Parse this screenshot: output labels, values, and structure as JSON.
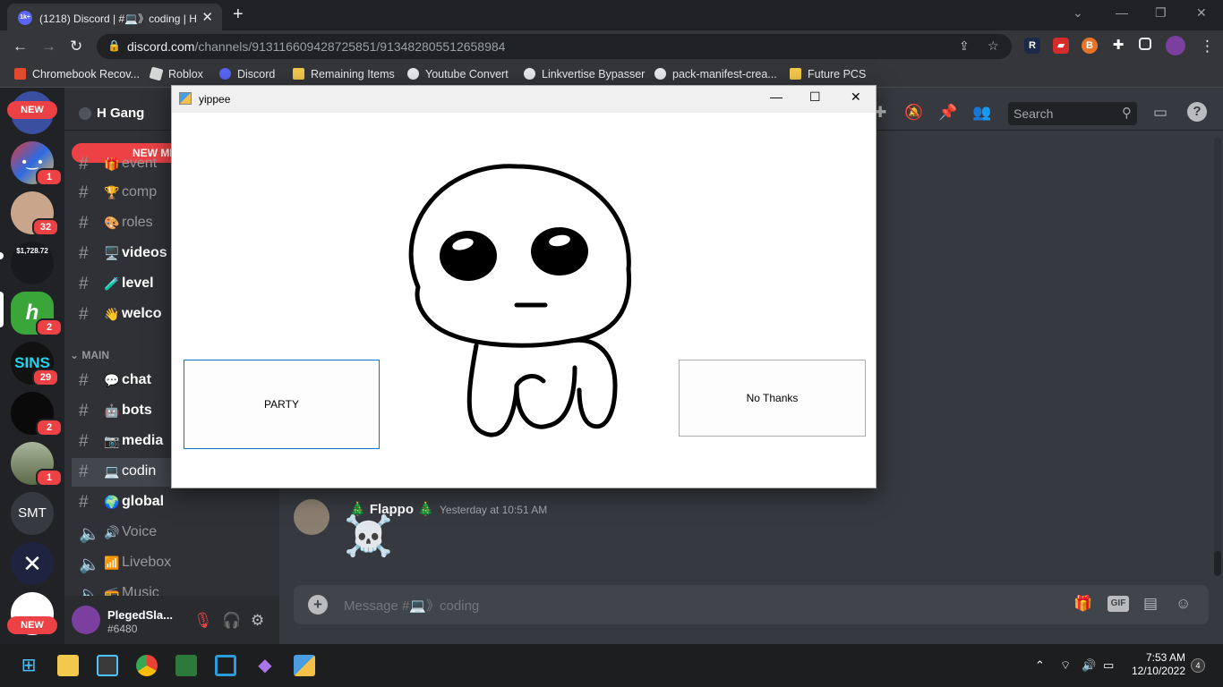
{
  "browser": {
    "tab_title": "(1218) Discord | #💻》coding | H",
    "tab_favicon": "1k+",
    "new_tab": "+",
    "url_host": "discord.com",
    "url_path": "/channels/913116609428725851/913482805512658984",
    "bookmarks": [
      "Chromebook Recov...",
      "Roblox",
      "Discord",
      "Remaining Items",
      "Youtube Convert",
      "Linkvertise Bypasser",
      "pack-manifest-crea...",
      "Future PCS"
    ]
  },
  "discord": {
    "server_name": "H Gang",
    "new_messages": "NEW ME",
    "guild_badges": {
      "g1": "1",
      "g2": "32",
      "g4": "2",
      "g5": "29",
      "g6": "2",
      "g7": "1"
    },
    "guild_labels": {
      "price": "$1,728.72",
      "smt": "SMT",
      "sins": "SINS",
      "new": "NEW",
      "new2": "NEW",
      "h": "h"
    },
    "channels_top": [
      {
        "emoji": "🎁",
        "name": "event"
      },
      {
        "emoji": "🏆",
        "name": "comp"
      },
      {
        "emoji": "🎨",
        "name": "roles"
      },
      {
        "emoji": "🖥️",
        "name": "videos"
      },
      {
        "emoji": "🧪",
        "name": "level"
      },
      {
        "emoji": "👋",
        "name": "welco"
      }
    ],
    "category_main": "MAIN",
    "channels_main": [
      {
        "emoji": "💬",
        "name": "chat"
      },
      {
        "emoji": "🤖",
        "name": "bots"
      },
      {
        "emoji": "📷",
        "name": "media"
      },
      {
        "emoji": "💻",
        "name": "codin"
      },
      {
        "emoji": "🌍",
        "name": "global"
      },
      {
        "emoji": "🔊",
        "name": "Voice"
      },
      {
        "emoji": "📶",
        "name": "Livebox"
      },
      {
        "emoji": "📻",
        "name": "Music"
      }
    ],
    "user": {
      "name": "PlegedSla...",
      "tag": "#6480"
    },
    "search_placeholder": "Search",
    "message": {
      "author": "🎄 Flappo 🎄",
      "time": "Yesterday at 10:51 AM",
      "content": "☠️"
    },
    "composer_placeholder": "Message #💻》coding",
    "gif_label": "GIF"
  },
  "dialog": {
    "title": "yippee",
    "party_button": "PARTY",
    "no_button": "No Thanks"
  },
  "taskbar": {
    "time": "7:53 AM",
    "date": "12/10/2022",
    "notifications": "4"
  }
}
